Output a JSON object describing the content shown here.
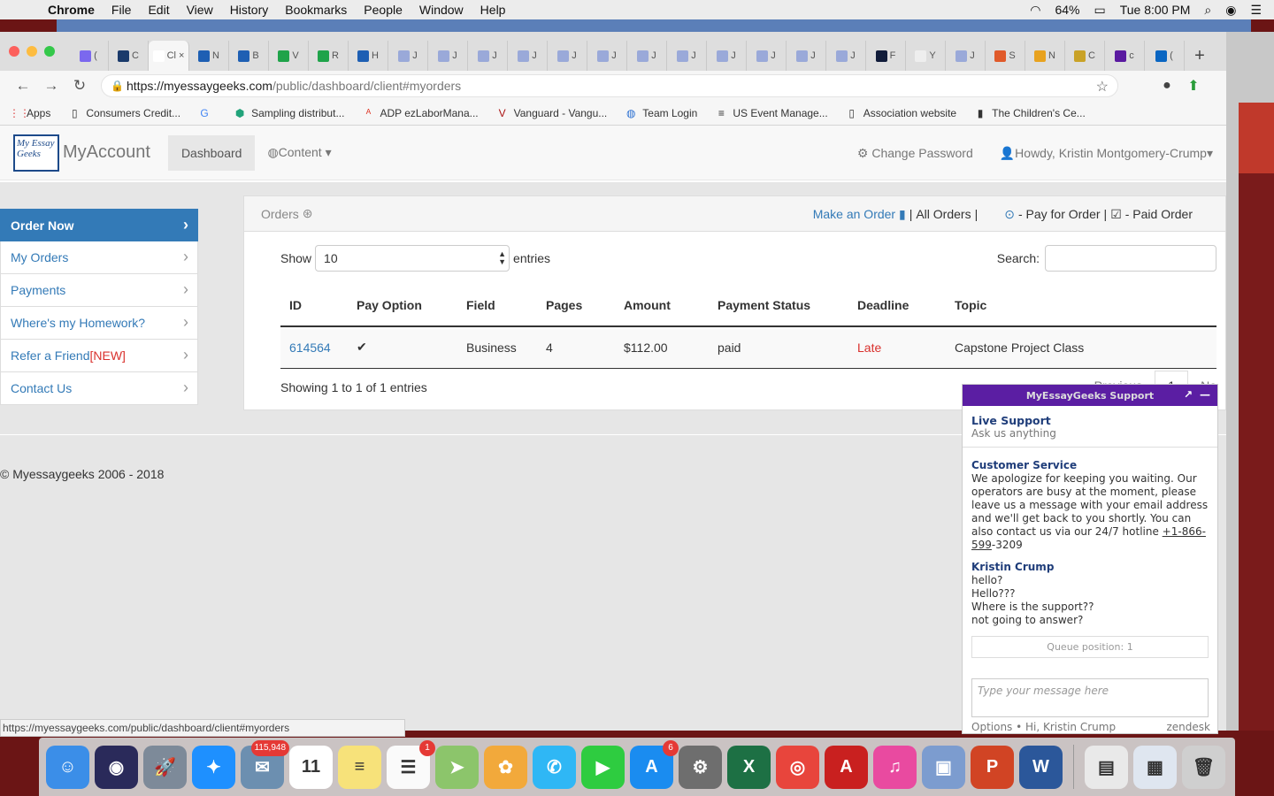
{
  "menubar": {
    "items": [
      "Chrome",
      "File",
      "Edit",
      "View",
      "History",
      "Bookmarks",
      "People",
      "Window",
      "Help"
    ],
    "battery": "64%",
    "clock": "Tue 8:00 PM"
  },
  "browser": {
    "tabs": [
      {
        "label": "(",
        "color": "#7b68ee"
      },
      {
        "label": "C",
        "color": "#1a3a6b"
      },
      {
        "label": "Cl",
        "color": "#ffffff",
        "active": true
      },
      {
        "label": "N",
        "color": "#1e5fb3"
      },
      {
        "label": "B",
        "color": "#1e5fb3"
      },
      {
        "label": "V",
        "color": "#1fa34a"
      },
      {
        "label": "R",
        "color": "#1fa34a"
      },
      {
        "label": "H",
        "color": "#1e5fb3"
      },
      {
        "label": "J",
        "color": "#9aa9d9"
      },
      {
        "label": "J",
        "color": "#9aa9d9"
      },
      {
        "label": "J",
        "color": "#9aa9d9"
      },
      {
        "label": "J",
        "color": "#9aa9d9"
      },
      {
        "label": "J",
        "color": "#9aa9d9"
      },
      {
        "label": "J",
        "color": "#9aa9d9"
      },
      {
        "label": "J",
        "color": "#9aa9d9"
      },
      {
        "label": "J",
        "color": "#9aa9d9"
      },
      {
        "label": "J",
        "color": "#9aa9d9"
      },
      {
        "label": "J",
        "color": "#9aa9d9"
      },
      {
        "label": "J",
        "color": "#9aa9d9"
      },
      {
        "label": "J",
        "color": "#9aa9d9"
      },
      {
        "label": "F",
        "color": "#111c3a"
      },
      {
        "label": "Y",
        "color": "#eeeeee"
      },
      {
        "label": "J",
        "color": "#9aa9d9"
      },
      {
        "label": "S",
        "color": "#e05a2a"
      },
      {
        "label": "N",
        "color": "#e8a21f"
      },
      {
        "label": "C",
        "color": "#c9a227"
      },
      {
        "label": "c",
        "color": "#5a1aa0"
      },
      {
        "label": "(",
        "color": "#0a66c2"
      }
    ],
    "new_tab": "+",
    "url_host": "https://myessaygeeks.com",
    "url_path": "/public/dashboard/client#myorders",
    "bookmarks": [
      {
        "label": "Apps",
        "icon": "apps-grid-icon"
      },
      {
        "label": "Consumers Credit...",
        "icon": "page-icon"
      },
      {
        "label": "",
        "icon": "google-icon"
      },
      {
        "label": "Sampling distribut...",
        "icon": "shield-icon"
      },
      {
        "label": "ADP ezLaborMana...",
        "icon": "adp-icon"
      },
      {
        "label": "Vanguard - Vangu...",
        "icon": "vanguard-icon"
      },
      {
        "label": "Team Login",
        "icon": "globe-icon"
      },
      {
        "label": "US Event Manage...",
        "icon": "event-icon"
      },
      {
        "label": "Association website",
        "icon": "page-icon"
      },
      {
        "label": "The Children's Ce...",
        "icon": "bookmark-icon"
      }
    ]
  },
  "site": {
    "logo_text": "My Essay Geeks",
    "brand": "MyAccount",
    "nav": {
      "dashboard": "Dashboard",
      "content": "Content"
    },
    "change_password": "Change Password",
    "howdy": "Howdy, Kristin Montgomery-Crump"
  },
  "sidebar": {
    "items": [
      {
        "label": "Order Now",
        "active": true
      },
      {
        "label": "My Orders"
      },
      {
        "label": "Payments"
      },
      {
        "label": "Where's my Homework?"
      },
      {
        "label": "Refer a Friend ",
        "tag": "[NEW]"
      },
      {
        "label": "Contact Us"
      }
    ]
  },
  "orders_panel": {
    "title": "Orders",
    "make_order": "Make an Order",
    "all_orders": "All Orders",
    "pay_for_order": "- Pay for Order",
    "paid_order": "- Paid Order",
    "show_label": "Show",
    "entries_value": "10",
    "entries_label": "entries",
    "search_label": "Search:",
    "columns": [
      "ID",
      "Pay Option",
      "Field",
      "Pages",
      "Amount",
      "Payment Status",
      "Deadline",
      "Topic"
    ],
    "rows": [
      {
        "id": "614564",
        "pay_option": "✔",
        "field": "Business",
        "pages": "4",
        "amount": "$112.00",
        "status": "paid",
        "deadline": "Late",
        "topic": "Capstone Project Class"
      }
    ],
    "showing": "Showing 1 to 1 of 1 entries",
    "pager": {
      "previous": "Previous",
      "page": "1",
      "next": "Ne"
    }
  },
  "footer": {
    "copyright": "© Myessaygeeks 2006 - 2018"
  },
  "chat": {
    "header": "MyEssayGeeks Support",
    "live_title": "Live Support",
    "live_sub": "Ask us anything",
    "agent_name": "Customer Service",
    "agent_msg": "We apologize for keeping you waiting. Our operators are busy at the moment, please leave us a message with your email address and we'll get back to you shortly. You can also contact us via our 24/7 hotline ",
    "agent_phone": "+1-866-599",
    "agent_phone_tail": "-3209",
    "user_name": "Kristin Crump",
    "user_msgs": [
      "hello?",
      "Hello???",
      "Where is the support??",
      "not going to answer?"
    ],
    "queue": "Queue position: 1",
    "input_placeholder": "Type your message here",
    "footer_left": "Options • Hi, Kristin Crump",
    "footer_right": "zendesk"
  },
  "status_url": "https://myessaygeeks.com/public/dashboard/client#myorders",
  "dock": {
    "apps": [
      {
        "name": "finder-icon",
        "color": "#3b8ee8",
        "glyph": "☺"
      },
      {
        "name": "siri-icon",
        "color": "#2a2a5a",
        "glyph": "◉"
      },
      {
        "name": "launchpad-icon",
        "color": "#7d8a99",
        "glyph": "🚀"
      },
      {
        "name": "safari-icon",
        "color": "#1e90ff",
        "glyph": "✦"
      },
      {
        "name": "mail-icon",
        "color": "#6c8fb0",
        "glyph": "✉",
        "badge": "115,948"
      },
      {
        "name": "calendar-icon",
        "color": "#ffffff",
        "glyph": "11"
      },
      {
        "name": "notes-icon",
        "color": "#f7e27a",
        "glyph": "≡"
      },
      {
        "name": "reminders-icon",
        "color": "#fafafa",
        "glyph": "☰",
        "badge": "1"
      },
      {
        "name": "maps-icon",
        "color": "#8cc56b",
        "glyph": "➤"
      },
      {
        "name": "photos-icon",
        "color": "#f2a93b",
        "glyph": "✿"
      },
      {
        "name": "messages-icon",
        "color": "#2fb7f5",
        "glyph": "✆"
      },
      {
        "name": "facetime-icon",
        "color": "#2ecc40",
        "glyph": "▶"
      },
      {
        "name": "app-store-icon",
        "color": "#1a8cf0",
        "glyph": "A",
        "badge": "6"
      },
      {
        "name": "system-preferences-icon",
        "color": "#6e6e6e",
        "glyph": "⚙"
      },
      {
        "name": "excel-icon",
        "color": "#1d7044",
        "glyph": "X"
      },
      {
        "name": "chrome-icon",
        "color": "#e8453c",
        "glyph": "◎"
      },
      {
        "name": "acrobat-icon",
        "color": "#c9201f",
        "glyph": "A"
      },
      {
        "name": "itunes-icon",
        "color": "#e94aa0",
        "glyph": "♫"
      },
      {
        "name": "preview-icon",
        "color": "#7c9ccf",
        "glyph": "▣"
      },
      {
        "name": "powerpoint-icon",
        "color": "#d14424",
        "glyph": "P"
      },
      {
        "name": "word-icon",
        "color": "#2b579a",
        "glyph": "W"
      }
    ],
    "right_apps": [
      {
        "name": "docx-file-icon",
        "color": "#e9e9e9",
        "glyph": "▤"
      },
      {
        "name": "document-window-icon",
        "color": "#dfe6f0",
        "glyph": "▦"
      },
      {
        "name": "trash-icon",
        "color": "#cfcfcf",
        "glyph": "🗑"
      }
    ]
  }
}
